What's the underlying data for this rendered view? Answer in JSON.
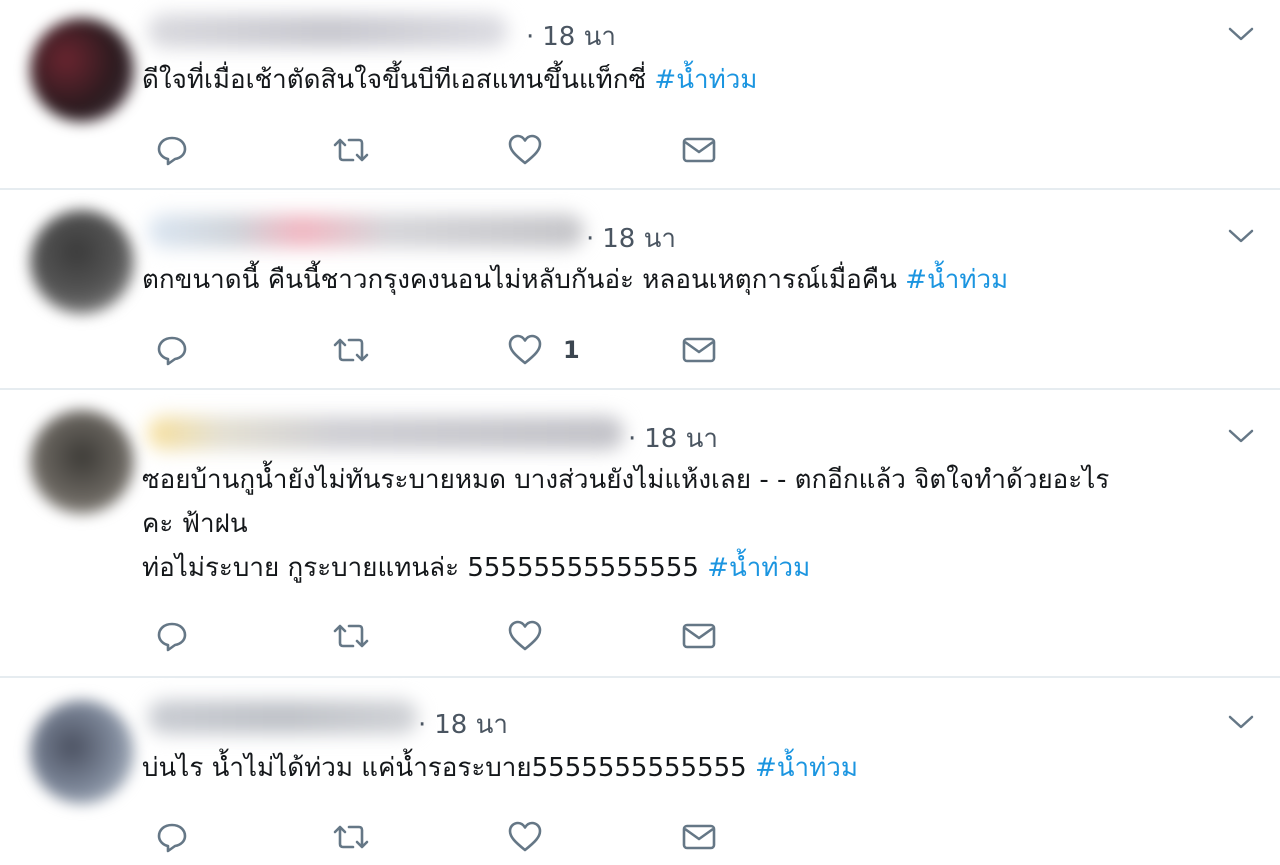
{
  "tweets": [
    {
      "time": "18 นา",
      "text": "ดีใจที่เมื่อเช้าตัดสินใจขึ้นบีทีเอสแทนขึ้นแท็กซี่ ",
      "hashtag": "#น้ำท่วม",
      "like_count": ""
    },
    {
      "time": "18 นา",
      "text": "ตกขนาดนี้ คืนนี้ชาวกรุงคงนอนไม่หลับกันอ่ะ หลอนเหตุการณ์เมื่อคืน ",
      "hashtag": "#น้ำท่วม",
      "like_count": "1"
    },
    {
      "time": "18 นา",
      "text_lines": [
        "ซอยบ้านกูน้ำยังไม่ทันระบายหมด บางส่วนยังไม่แห้งเลย - - ตกอีกแล้ว จิตใจทำด้วยอะไร",
        "คะ ฟ้าฝน"
      ],
      "text": "ท่อไม่ระบาย กูระบายแทนล่ะ 55555555555555 ",
      "hashtag": "#น้ำท่วม",
      "like_count": ""
    },
    {
      "time": "18 นา",
      "text": "บ่นไร น้ำไม่ได้ท่วม แค่น้ำรอระบาย5555555555555 ",
      "hashtag": "#น้ำท่วม",
      "like_count": ""
    }
  ],
  "colors": {
    "hashtag": "#1b95e0",
    "icon": "#657786",
    "divider": "#e6ecf0"
  },
  "icons": [
    "reply-icon",
    "retweet-icon",
    "like-icon",
    "direct-message-icon",
    "chevron-down-icon"
  ]
}
